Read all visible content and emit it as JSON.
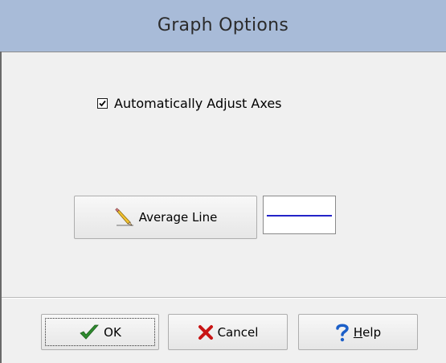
{
  "window": {
    "title": "Graph Options"
  },
  "options": {
    "auto_adjust_label": "Automatically Adjust Axes",
    "auto_adjust_checked": true
  },
  "average_line": {
    "button_label": "Average Line",
    "button_icon": "pencil-icon",
    "line_color": "#2323c8"
  },
  "buttons": {
    "ok_label": "OK",
    "ok_icon": "checkmark-icon",
    "cancel_label": "Cancel",
    "cancel_icon": "x-icon",
    "help_label_first": "H",
    "help_label_rest": "elp",
    "help_icon": "question-mark-icon"
  },
  "colors": {
    "title_bar": "#a8bbd8",
    "dialog_bg": "#f0f0f0",
    "ok_check": "#2e8b2e",
    "cancel_x": "#c81414",
    "help_q": "#1c5fc8"
  }
}
